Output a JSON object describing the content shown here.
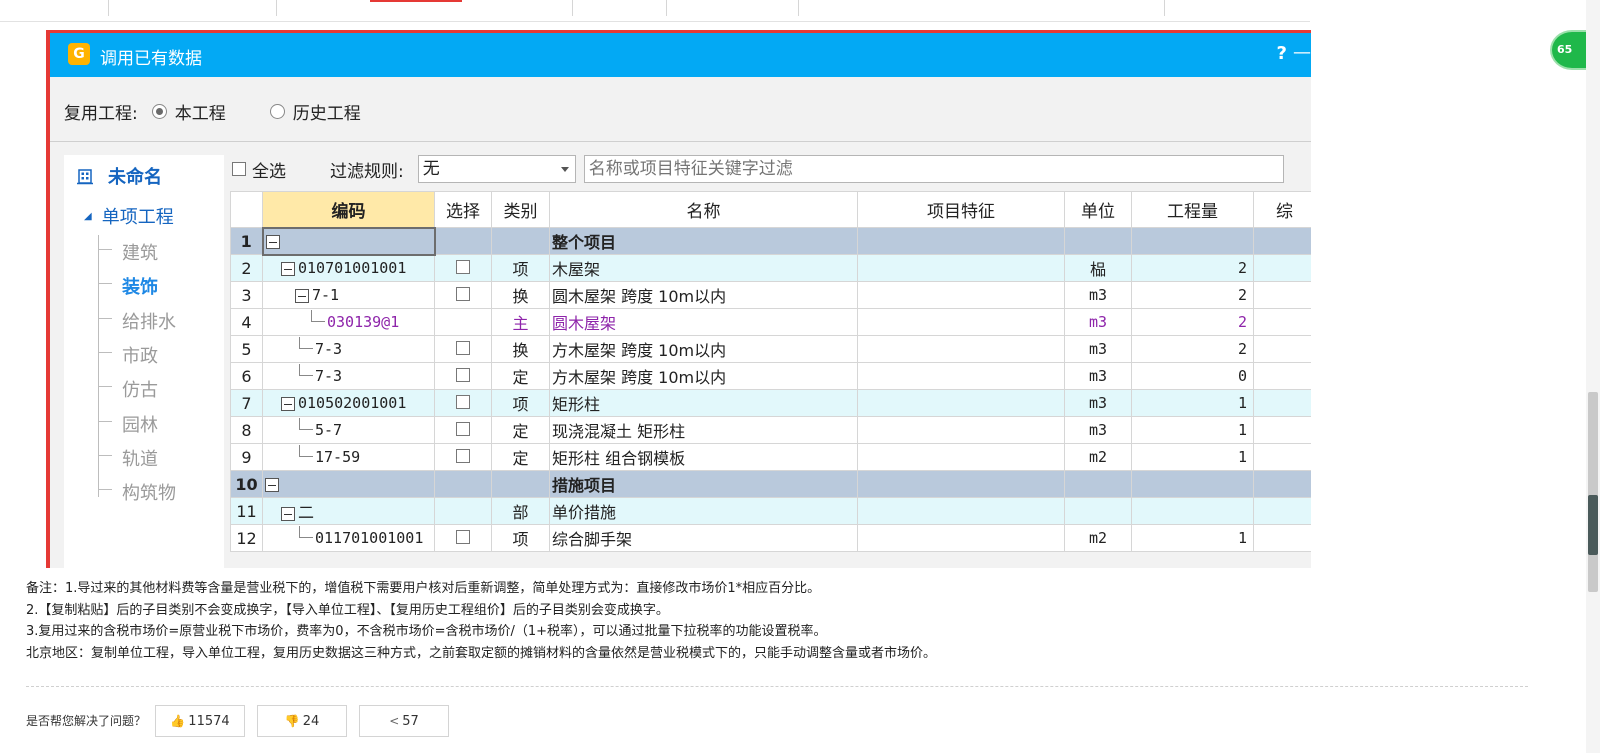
{
  "dialog": {
    "title": "调用已有数据",
    "help": "?",
    "close": "—",
    "reuse_label": "复用工程:",
    "reuse_options": [
      "本工程",
      "历史工程"
    ]
  },
  "tree": {
    "root": "未命名",
    "sub": "单项工程",
    "items": [
      "建筑",
      "装饰",
      "给排水",
      "市政",
      "仿古",
      "园林",
      "轨道",
      "构筑物"
    ],
    "active": "装饰"
  },
  "filter": {
    "select_all": "全选",
    "rule_label": "过滤规则:",
    "rule_value": "无",
    "keyword_placeholder": "名称或项目特征关键字过滤"
  },
  "table": {
    "headers": [
      "编码",
      "选择",
      "类别",
      "名称",
      "项目特征",
      "单位",
      "工程量",
      "综"
    ],
    "rows": [
      {
        "num": "1",
        "code": "",
        "cat": "",
        "name": "整个项目",
        "unit": "",
        "qty": ""
      },
      {
        "num": "2",
        "code": "010701001001",
        "cat": "项",
        "name": "木屋架",
        "unit": "榀",
        "qty": "2"
      },
      {
        "num": "3",
        "code": "7-1",
        "cat": "换",
        "name": "圆木屋架 跨度 10m以内",
        "unit": "m3",
        "qty": "2"
      },
      {
        "num": "4",
        "code": "030139@1",
        "cat": "主",
        "name": "圆木屋架",
        "unit": "m3",
        "qty": "2"
      },
      {
        "num": "5",
        "code": "7-3",
        "cat": "换",
        "name": "方木屋架 跨度 10m以内",
        "unit": "m3",
        "qty": "2"
      },
      {
        "num": "6",
        "code": "7-3",
        "cat": "定",
        "name": "方木屋架 跨度 10m以内",
        "unit": "m3",
        "qty": "0"
      },
      {
        "num": "7",
        "code": "010502001001",
        "cat": "项",
        "name": "矩形柱",
        "unit": "m3",
        "qty": "1"
      },
      {
        "num": "8",
        "code": "5-7",
        "cat": "定",
        "name": "现浇混凝土 矩形柱",
        "unit": "m3",
        "qty": "1"
      },
      {
        "num": "9",
        "code": "17-59",
        "cat": "定",
        "name": "矩形柱 组合钢模板",
        "unit": "m2",
        "qty": "1"
      },
      {
        "num": "10",
        "code": "",
        "cat": "",
        "name": "措施项目",
        "unit": "",
        "qty": ""
      },
      {
        "num": "11",
        "code": "二",
        "cat": "部",
        "name": "单价措施",
        "unit": "",
        "qty": ""
      },
      {
        "num": "12",
        "code": "011701001001",
        "cat": "项",
        "name": "综合脚手架",
        "unit": "m2",
        "qty": "1"
      }
    ]
  },
  "notes": [
    "备注：1.导过来的其他材料费等含量是营业税下的，增值税下需要用户核对后重新调整，简单处理方式为：直接修改市场价1*相应百分比。",
    "2.【复制粘贴】后的子目类别不会变成换字，【导入单位工程】、【复用历史工程组价】后的子目类别会变成换字。",
    "3.复用过来的含税市场价=原营业税下市场价，费率为0，不含税市场价=含税市场价/（1+税率），可以通过批量下拉税率的功能设置税率。",
    "北京地区：复制单位工程，导入单位工程，复用历史数据这三种方式，之前套取定额的摊销材料的含量依然是营业税模式下的，只能手动调整含量或者市场价。"
  ],
  "feedback": {
    "question": "是否帮您解决了问题？",
    "like": "11574",
    "dislike": "24",
    "share": "57"
  },
  "badge": "65"
}
